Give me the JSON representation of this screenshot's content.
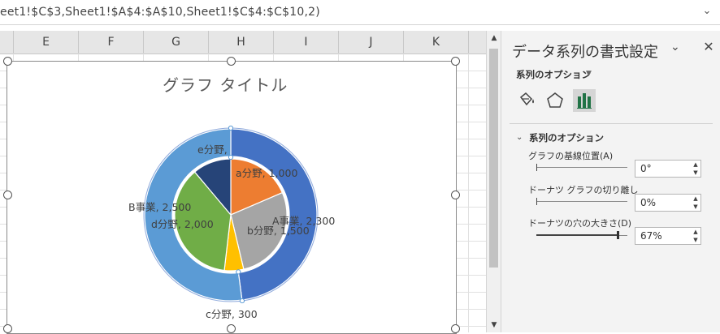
{
  "formula_bar": {
    "text": "eet1!$C$3,Sheet1!$A$4:$A$10,Sheet1!$C$4:$C$10,2)"
  },
  "columns": [
    "E",
    "F",
    "G",
    "H",
    "I",
    "J",
    "K"
  ],
  "chart": {
    "title": "グラフ タイトル",
    "outer_ring": [
      {
        "name": "A事業",
        "value": 2300,
        "label": "A事業, 2,300",
        "color": "#4472c4"
      },
      {
        "name": "B事業",
        "value": 2500,
        "label": "B事業, 2,500",
        "color": "#5b9bd5"
      }
    ],
    "inner_ring": [
      {
        "name": "a分野",
        "value": 1000,
        "label": "a分野, 1,000",
        "color": "#ed7d31"
      },
      {
        "name": "b分野",
        "value": 1500,
        "label": "b分野, 1,500",
        "color": "#a5a5a5"
      },
      {
        "name": "c分野",
        "value": 300,
        "label": "c分野, 300",
        "color": "#ffc000"
      },
      {
        "name": "d分野",
        "value": 2000,
        "label": "d分野, 2,000",
        "color": "#70ad47"
      },
      {
        "name": "e分野",
        "value": 600,
        "label": "e分野,",
        "color": "#264478"
      }
    ]
  },
  "pane": {
    "title": "データ系列の書式設定",
    "tab_label": "系列のオプション",
    "section_title": "系列のオプション",
    "options": [
      {
        "label": "グラフの基線位置(A)",
        "value": "0°",
        "level": 0
      },
      {
        "label": "ドーナツ グラフの切り離し",
        "value": "0%",
        "level": 0
      },
      {
        "label": "ドーナツの穴の大きさ(D)",
        "value": "67%",
        "level": 0.67
      }
    ],
    "icons": [
      "fill-line-icon",
      "effects-icon",
      "series-options-icon"
    ]
  }
}
